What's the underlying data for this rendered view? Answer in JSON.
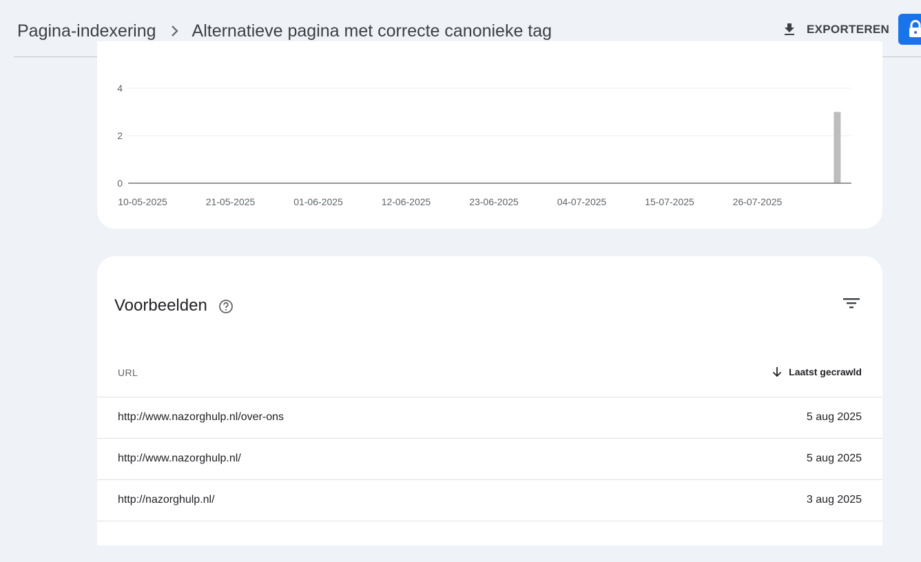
{
  "header": {
    "breadcrumb_parent": "Pagina-indexering",
    "breadcrumb_current": "Alternatieve pagina met correcte canonieke tag",
    "export_label": "EXPORTEREN"
  },
  "chart_data": {
    "type": "bar",
    "x_tick_labels": [
      "10-05-2025",
      "21-05-2025",
      "01-06-2025",
      "12-06-2025",
      "23-06-2025",
      "04-07-2025",
      "15-07-2025",
      "26-07-2025"
    ],
    "y_tick_labels": [
      "0",
      "2",
      "4"
    ],
    "ylim": [
      0,
      4
    ],
    "series": [
      {
        "x": "05-08-2025",
        "y": 3
      }
    ],
    "bar_color": "#bdbdbd",
    "grid": true
  },
  "examples": {
    "title": "Voorbeelden",
    "columns": {
      "url": "URL",
      "last_crawled": "Laatst gecrawld"
    },
    "rows": [
      {
        "url": "http://www.nazorghulp.nl/over-ons",
        "date": "5 aug 2025"
      },
      {
        "url": "http://www.nazorghulp.nl/",
        "date": "5 aug 2025"
      },
      {
        "url": "http://nazorghulp.nl/",
        "date": "3 aug 2025"
      },
      {
        "url": "",
        "date": ""
      }
    ]
  },
  "colors": {
    "page_background": "#eff2f6",
    "accent": "#1a73e8"
  },
  "icons": {
    "breadcrumb_separator": "chevron-right-icon",
    "export": "download-icon",
    "lock": "lock-icon",
    "help": "help-circle-icon",
    "filter": "filter-icon",
    "sort": "arrow-down-icon"
  }
}
